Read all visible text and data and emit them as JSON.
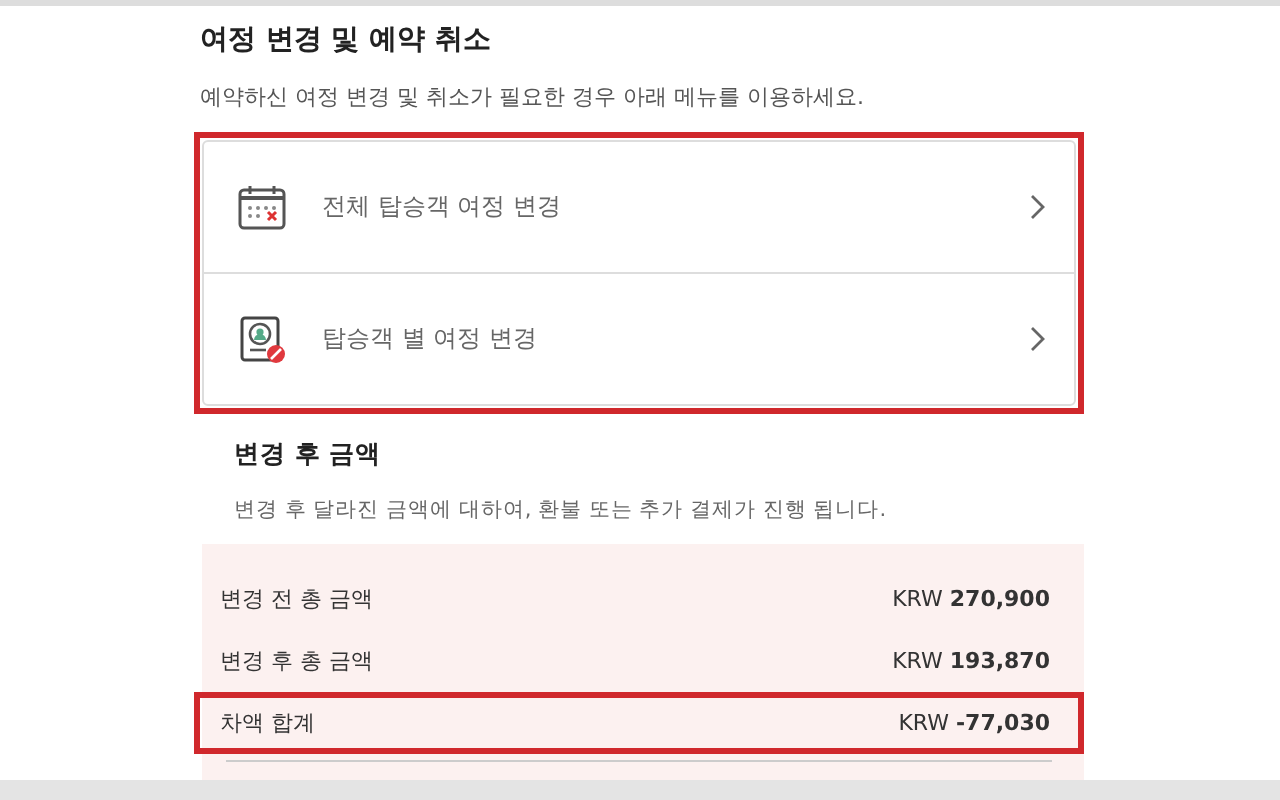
{
  "section": {
    "title": "여정 변경 및 예약 취소",
    "description": "예약하신 여정 변경 및 취소가 필요한 경우 아래 메뉴를 이용하세요."
  },
  "menu": {
    "highlighted": true,
    "items": [
      {
        "kind": "calendar",
        "label": "전체 탑승객 여정 변경"
      },
      {
        "kind": "passenger",
        "label": "탑승객 별 여정 변경"
      }
    ]
  },
  "amount": {
    "title": "변경 후 금액",
    "description": "변경 후 달라진 금액에 대하여, 환불 또는 추가 결제가 진행 됩니다.",
    "rows": [
      {
        "label": "변경 전 총 금액",
        "value": "KRW **270,900**",
        "highlighted": false
      },
      {
        "label": "변경 후 총 금액",
        "value": "KRW **193,870**",
        "highlighted": false
      },
      {
        "label": "차액 합계",
        "value": "KRW **-77,030**",
        "highlighted": true
      }
    ]
  }
}
